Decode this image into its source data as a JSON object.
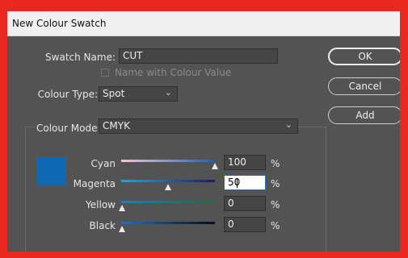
{
  "dialog": {
    "title": "New Colour Swatch"
  },
  "swatch_name": {
    "label": "Swatch Name:",
    "value": "CUT"
  },
  "name_with_colour_value": {
    "label": "Name with Colour Value",
    "checked": false
  },
  "colour_type": {
    "label": "Colour Type:",
    "value": "Spot"
  },
  "colour_mode": {
    "label": "Colour Mode:",
    "value": "CMYK"
  },
  "buttons": {
    "ok": "OK",
    "cancel": "Cancel",
    "add": "Add"
  },
  "swatch_color": "#0f68b4",
  "sliders": [
    {
      "label": "Cyan",
      "value": "100",
      "unit": "%",
      "level": 1.0
    },
    {
      "label": "Magenta",
      "value": "50",
      "unit": "%",
      "level": 0.5
    },
    {
      "label": "Yellow",
      "value": "0",
      "unit": "%",
      "level": 0
    },
    {
      "label": "Black",
      "value": "0",
      "unit": "%",
      "level": 0
    }
  ]
}
